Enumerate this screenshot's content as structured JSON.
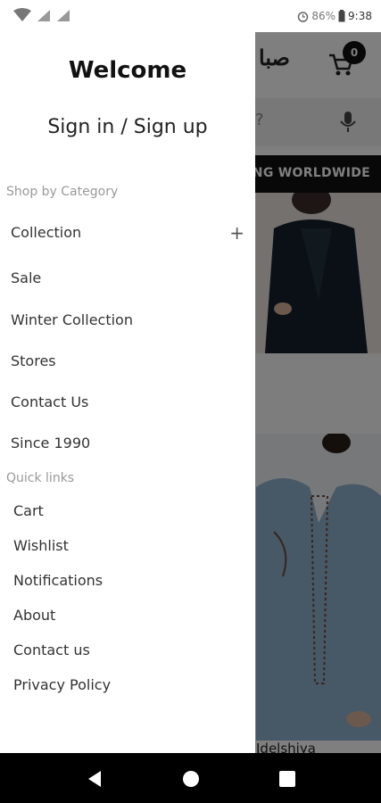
{
  "status_bar": {
    "battery": "86%",
    "time": "9:38"
  },
  "background_app": {
    "logo": "صبا",
    "cart_count": "0",
    "search_hint": "?",
    "promo_text": "FREE SHIPPING WORLDWIDE",
    "product_title": "Idelshiya"
  },
  "drawer": {
    "welcome": "Welcome",
    "sign_in": "Sign in / Sign up",
    "category_heading": "Shop by Category",
    "categories": [
      {
        "label": "Collection",
        "expand": "+"
      },
      {
        "label": "Sale"
      },
      {
        "label": "Winter Collection"
      },
      {
        "label": "Stores"
      },
      {
        "label": "Contact Us"
      },
      {
        "label": "Since 1990"
      }
    ],
    "quick_heading": "Quick links",
    "quick_links": [
      "Cart",
      "Wishlist",
      "Notifications",
      "About",
      "Contact us",
      "Privacy Policy"
    ]
  }
}
